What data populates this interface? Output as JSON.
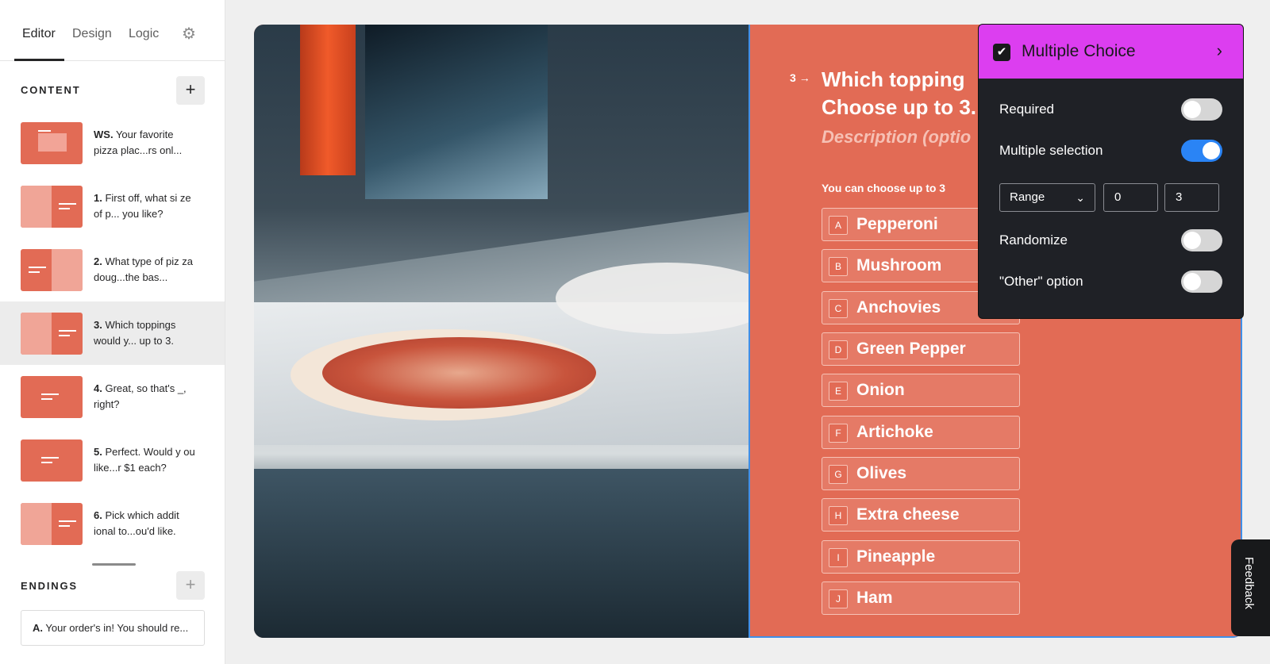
{
  "sidebar": {
    "tabs": [
      {
        "label": "Editor"
      },
      {
        "label": "Design"
      },
      {
        "label": "Logic"
      }
    ],
    "settings_icon": "gear-icon",
    "content_heading": "CONTENT",
    "add_label": "+",
    "items": [
      {
        "prefix": "WS.",
        "text": "Your favorite pizza plac...rs onl..."
      },
      {
        "prefix": "1.",
        "text": "First off, what si ze of p... you like?"
      },
      {
        "prefix": "2.",
        "text": "What type of piz za doug...the bas..."
      },
      {
        "prefix": "3.",
        "text": "Which toppings would y... up to 3."
      },
      {
        "prefix": "4.",
        "text": "Great, so that's _, right?"
      },
      {
        "prefix": "5.",
        "text": "Perfect. Would y ou like...r $1 each?"
      },
      {
        "prefix": "6.",
        "text": "Pick which addit ional to...ou'd like."
      }
    ],
    "endings_heading": "ENDINGS",
    "ending": {
      "prefix": "A.",
      "text": "Your order's in! You should re..."
    }
  },
  "question": {
    "number": "3",
    "arrow": "→",
    "title": "Which topping\nChoose up to 3.",
    "description": "Description (optio",
    "hint": "You can choose up to 3",
    "choices": [
      {
        "key": "A",
        "label": "Pepperoni"
      },
      {
        "key": "B",
        "label": "Mushroom"
      },
      {
        "key": "C",
        "label": "Anchovies"
      },
      {
        "key": "D",
        "label": "Green Pepper"
      },
      {
        "key": "E",
        "label": "Onion"
      },
      {
        "key": "F",
        "label": "Artichoke"
      },
      {
        "key": "G",
        "label": "Olives"
      },
      {
        "key": "H",
        "label": "Extra cheese"
      },
      {
        "key": "I",
        "label": "Pineapple"
      },
      {
        "key": "J",
        "label": "Ham"
      }
    ]
  },
  "settings": {
    "type_label": "Multiple Choice",
    "required": {
      "label": "Required",
      "on": false
    },
    "multiple_selection": {
      "label": "Multiple selection",
      "on": true
    },
    "range": {
      "label": "Range",
      "min": "0",
      "max": "3"
    },
    "randomize": {
      "label": "Randomize",
      "on": false
    },
    "other_option": {
      "label": "\"Other\" option",
      "on": false
    }
  },
  "feedback_label": "Feedback",
  "colors": {
    "accent": "#e26b55",
    "popover_header": "#dc3ef0",
    "toggle_on": "#2a84f5"
  }
}
